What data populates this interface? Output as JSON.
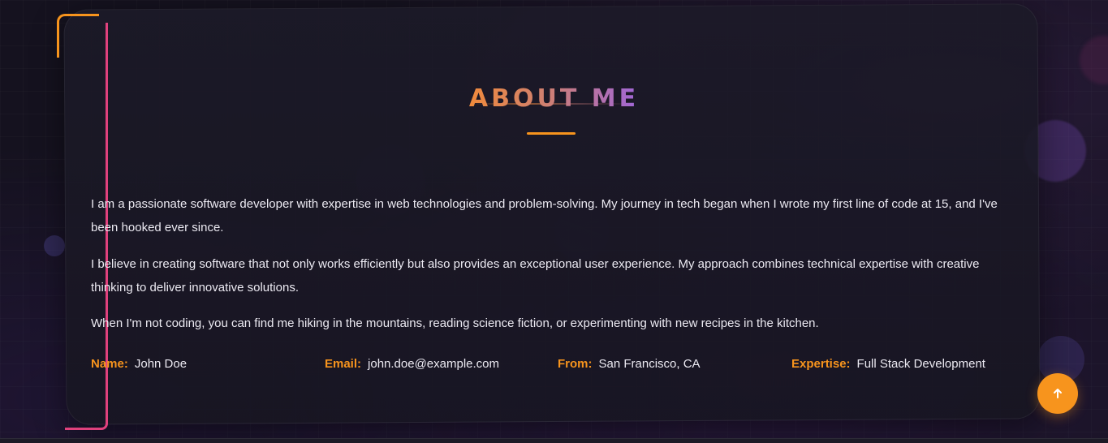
{
  "section": {
    "title": "ABOUT ME"
  },
  "about": {
    "paragraphs": [
      "I am a passionate software developer with expertise in web technologies and problem-solving. My journey in tech began when I wrote my first line of code at 15, and I've been hooked ever since.",
      "I believe in creating software that not only works efficiently but also provides an exceptional user experience. My approach combines technical expertise with creative thinking to deliver innovative solutions.",
      "When I'm not coding, you can find me hiking in the mountains, reading science fiction, or experimenting with new recipes in the kitchen."
    ],
    "info": [
      {
        "label": "Name:",
        "value": "John Doe"
      },
      {
        "label": "Email:",
        "value": "john.doe@example.com"
      },
      {
        "label": "From:",
        "value": "San Francisco, CA"
      },
      {
        "label": "Expertise:",
        "value": "Full Stack Development"
      }
    ]
  },
  "scroll_top": {
    "icon": "arrow-up-icon"
  },
  "colors": {
    "accent": "#f7941d",
    "accent_pink": "#e0417d",
    "title_gradient_start": "#f08a3c",
    "title_gradient_end": "#a066d8",
    "background": "#15121f"
  }
}
